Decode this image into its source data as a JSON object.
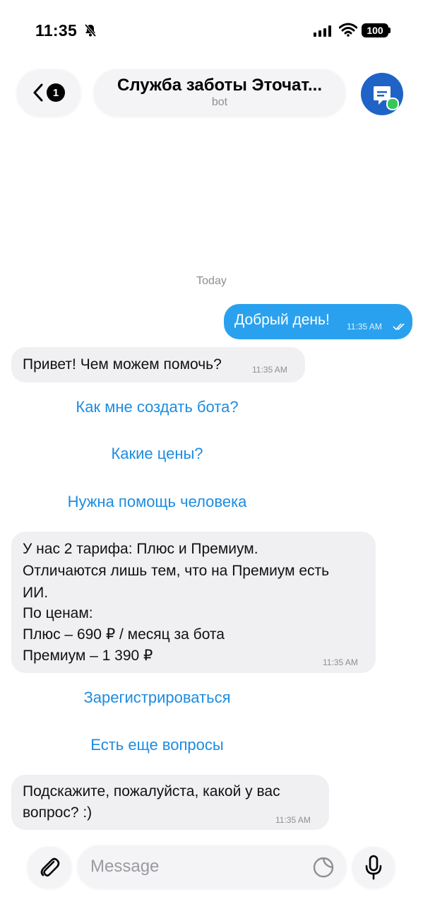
{
  "status_bar": {
    "time": "11:35",
    "battery": "100",
    "icons": [
      "bell-slash-icon",
      "signal-icon",
      "wifi-icon",
      "battery-icon"
    ]
  },
  "header": {
    "back_badge": "1",
    "title": "Служба заботы Эточат...",
    "subtitle": "bot",
    "avatar_color": "#1f63c7"
  },
  "chat": {
    "date_separator": "Today",
    "outgoing": {
      "text": "Добрый день!",
      "time": "11:35 AM"
    },
    "incoming_1": {
      "text": "Привет! Чем можем помочь?",
      "time": "11:35 AM"
    },
    "quick_replies_1": [
      "Как мне создать бота?",
      "Какие цены?",
      "Нужна помощь человека"
    ],
    "incoming_2": {
      "lines": [
        "У нас 2 тарифа: Плюс и Премиум.",
        "Отличаются лишь тем, что на Премиум есть",
        "ИИ.",
        "По ценам:",
        "Плюс – 690 ₽ / месяц за бота",
        "Премиум – 1 390 ₽"
      ],
      "time": "11:35 AM"
    },
    "quick_replies_2": [
      "Зарегистрироваться",
      "Есть еще вопросы"
    ],
    "incoming_3": {
      "lines": [
        "Подскажите, пожалуйста, какой у вас",
        "вопрос? :)"
      ],
      "time": "11:35 AM"
    }
  },
  "input_bar": {
    "placeholder": "Message",
    "icons": [
      "paperclip-icon",
      "sticker-icon",
      "microphone-icon"
    ]
  },
  "colors": {
    "outgoing_bubble": "#2aa1ee",
    "incoming_bubble": "#f0f0f3",
    "link": "#1d8ce0"
  }
}
